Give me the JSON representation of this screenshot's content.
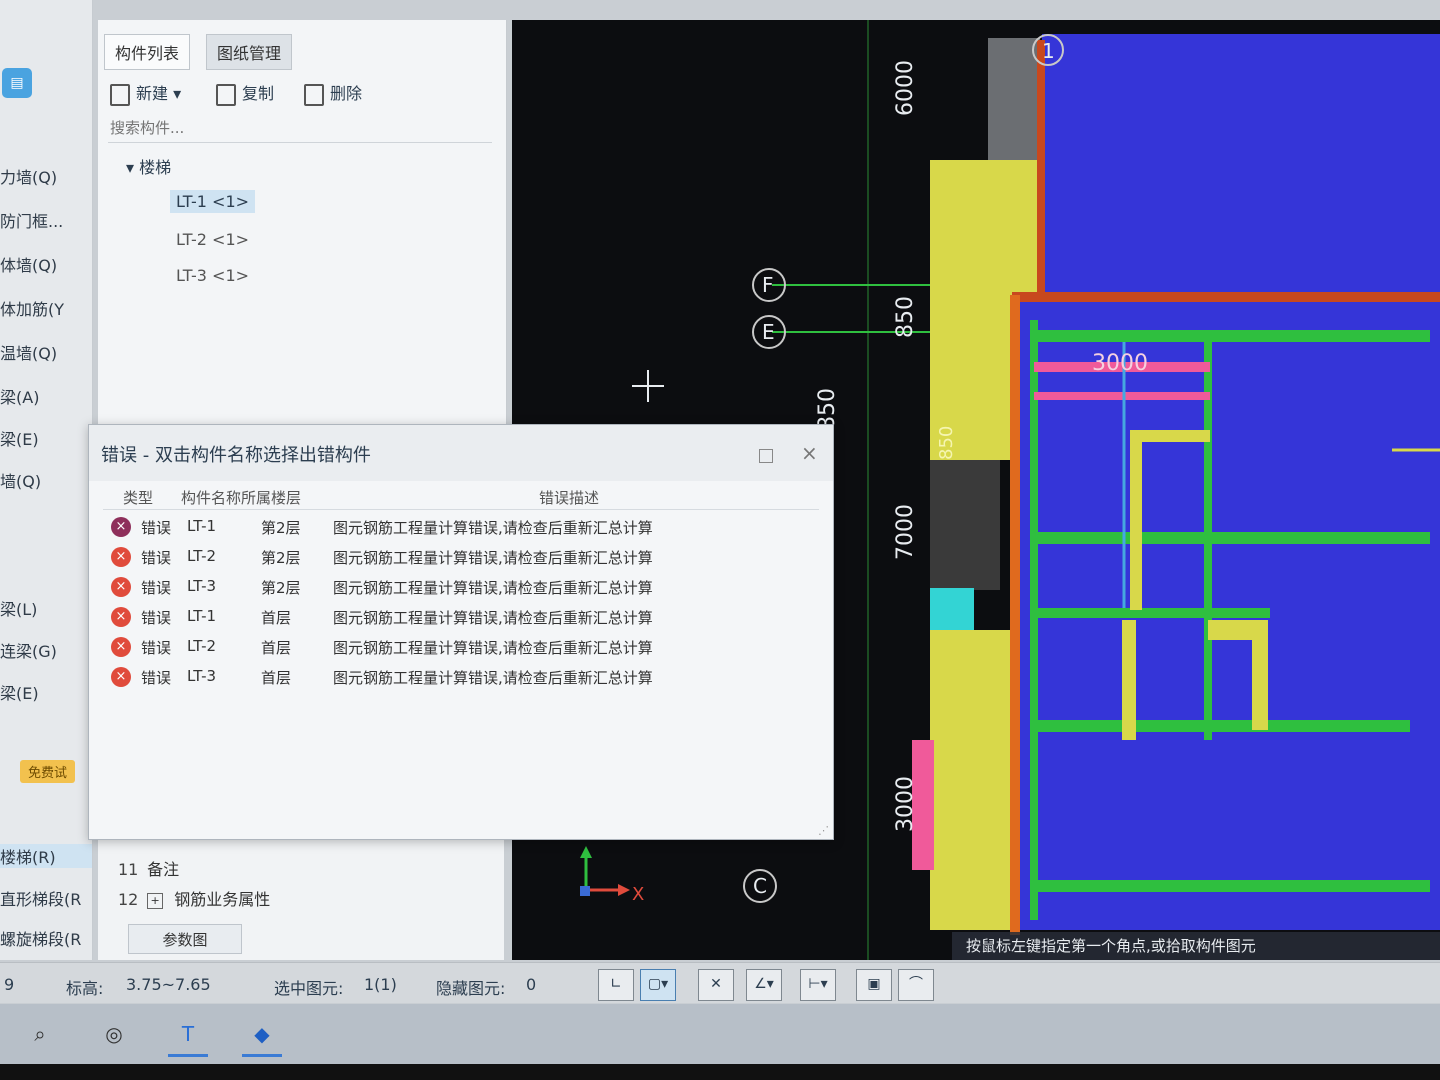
{
  "left_nav": {
    "items": [
      {
        "label": "力墙(Q)",
        "selected": false
      },
      {
        "label": "防门框...",
        "selected": false
      },
      {
        "label": "体墙(Q)",
        "selected": false
      },
      {
        "label": "体加筋(Y",
        "selected": false
      },
      {
        "label": "温墙(Q)",
        "selected": false
      },
      {
        "label": "梁(A)",
        "selected": false
      },
      {
        "label": "梁(E)",
        "selected": false
      },
      {
        "label": "墙(Q)",
        "selected": false
      },
      {
        "label": "梁(L)",
        "selected": false
      },
      {
        "label": "连梁(G)",
        "selected": false
      },
      {
        "label": "梁(E)",
        "selected": false
      },
      {
        "label": "楼梯(R)",
        "selected": true
      },
      {
        "label": "直形梯段(R",
        "selected": false
      },
      {
        "label": "螺旋梯段(R",
        "selected": false
      }
    ],
    "try_badge": "免费试"
  },
  "component_panel": {
    "tabs": [
      "构件列表",
      "图纸管理"
    ],
    "toolbar": {
      "new": "新建",
      "copy": "复制",
      "delete": "删除"
    },
    "search_placeholder": "搜索构件...",
    "tree_category": "楼梯",
    "tree_items": [
      "LT-1 <1>",
      "LT-2 <1>",
      "LT-3 <1>"
    ]
  },
  "property_area": {
    "rows": [
      {
        "num": "11",
        "label": "备注",
        "expand": false
      },
      {
        "num": "12",
        "label": "钢筋业务属性",
        "expand": true
      }
    ],
    "param_button": "参数图"
  },
  "error_dialog": {
    "title": "错误 - 双击构件名称选择出错构件",
    "columns": {
      "type": "类型",
      "name_floor": "构件名称所属楼层",
      "desc": "错误描述"
    },
    "rows": [
      {
        "type": "错误",
        "name": "LT-1",
        "floor": "第2层",
        "desc": "图元钢筋工程量计算错误,请检查后重新汇总计算"
      },
      {
        "type": "错误",
        "name": "LT-2",
        "floor": "第2层",
        "desc": "图元钢筋工程量计算错误,请检查后重新汇总计算"
      },
      {
        "type": "错误",
        "name": "LT-3",
        "floor": "第2层",
        "desc": "图元钢筋工程量计算错误,请检查后重新汇总计算"
      },
      {
        "type": "错误",
        "name": "LT-1",
        "floor": "首层",
        "desc": "图元钢筋工程量计算错误,请检查后重新汇总计算"
      },
      {
        "type": "错误",
        "name": "LT-2",
        "floor": "首层",
        "desc": "图元钢筋工程量计算错误,请检查后重新汇总计算"
      },
      {
        "type": "错误",
        "name": "LT-3",
        "floor": "首层",
        "desc": "图元钢筋工程量计算错误,请检查后重新汇总计算"
      }
    ]
  },
  "cad": {
    "axis_labels": [
      "1",
      "F",
      "E",
      "C"
    ],
    "dimensions": [
      "6000",
      "850",
      "850",
      "7000",
      "3000",
      "3000",
      "850"
    ],
    "hint": "按鼠标左键指定第一个角点,或拾取构件图元",
    "axis_x_label": "X"
  },
  "status_bar": {
    "scale": "9",
    "elevation_label": "标高:",
    "elevation_value": "3.75~7.65",
    "selected_label": "选中图元:",
    "selected_value": "1(1)",
    "hidden_label": "隐藏图元:",
    "hidden_value": "0"
  },
  "taskbar": {
    "apps": [
      "search-icon",
      "dell-icon",
      "gtj-app-icon",
      "cursor-app-icon"
    ]
  },
  "colors": {
    "cad_background": "#0c0d10",
    "cad_blue": "#3535d8",
    "cad_green": "#2fbf3f",
    "cad_yellow": "#d8d84a",
    "error_red": "#e04b3c"
  }
}
